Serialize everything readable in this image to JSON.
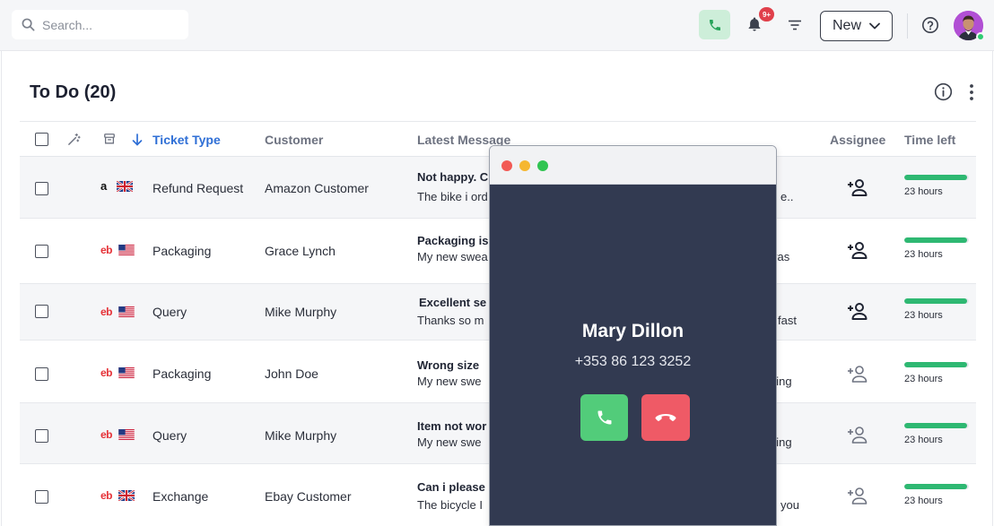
{
  "search": {
    "placeholder": "Search..."
  },
  "header": {
    "notification_badge": "9+",
    "new_button_label": "New"
  },
  "page": {
    "title": "To Do (20)"
  },
  "table": {
    "columns": {
      "ticket_type": "Ticket Type",
      "customer": "Customer",
      "latest_message": "Latest Message",
      "assignee": "Assignee",
      "time_left": "Time left"
    },
    "rows": [
      {
        "marketplace": "amazon",
        "marketplace_mark": "a",
        "country": "GB",
        "ticket_type": "Refund Request",
        "customer": "Amazon Customer",
        "message_title": "Not happy. C",
        "message_body": "The bike i ord",
        "message_tail": "e..",
        "time_left": "23 hours",
        "time_progress": 0.97
      },
      {
        "marketplace": "ebay",
        "marketplace_mark": "eb",
        "country": "US",
        "ticket_type": "Packaging",
        "customer": "Grace Lynch",
        "message_title": "Packaging is",
        "message_body": "My new swea",
        "message_tail": "vas",
        "time_left": "23 hours",
        "time_progress": 0.97
      },
      {
        "marketplace": "ebay",
        "marketplace_mark": "eb",
        "country": "US",
        "ticket_type": "Query",
        "customer": "Mike Murphy",
        "message_title": "Excellent se",
        "message_body": "Thanks so m",
        "message_tail": "fast",
        "time_left": "23 hours",
        "time_progress": 0.97
      },
      {
        "marketplace": "ebay",
        "marketplace_mark": "eb",
        "country": "US",
        "ticket_type": "Packaging",
        "customer": "John Doe",
        "message_title": "Wrong size",
        "message_body": "My new swe",
        "message_tail": "ging",
        "time_left": "23 hours",
        "time_progress": 0.97
      },
      {
        "marketplace": "ebay",
        "marketplace_mark": "eb",
        "country": "US",
        "ticket_type": "Query",
        "customer": "Mike Murphy",
        "message_title": "Item not wor",
        "message_body": "My new swe",
        "message_tail": "ging",
        "time_left": "23 hours",
        "time_progress": 0.97
      },
      {
        "marketplace": "ebay",
        "marketplace_mark": "eb",
        "country": "GB",
        "ticket_type": "Exchange",
        "customer": "Ebay Customer",
        "message_title": "Can i please",
        "message_body": "The bicycle I",
        "message_tail": "you",
        "time_left": "23 hours",
        "time_progress": 0.97
      }
    ]
  },
  "call": {
    "caller_name": "Mary Dillon",
    "caller_number": "+353 86 123 3252"
  },
  "colors": {
    "accent_blue": "#2f6fd6",
    "progress_green": "#2eb872",
    "accept_green": "#52cc7a",
    "decline_red": "#ef5a66",
    "call_bg": "#323a51",
    "badge_red": "#e0404b"
  },
  "icons": [
    "search-icon",
    "phone-icon",
    "bell-icon",
    "filter-icon",
    "chevron-down-icon",
    "help-icon",
    "info-icon",
    "more-vertical-icon",
    "magic-wand-icon",
    "archive-box-icon",
    "arrow-down-icon",
    "add-user-icon",
    "uk-flag-icon",
    "us-flag-icon",
    "end-call-icon"
  ]
}
